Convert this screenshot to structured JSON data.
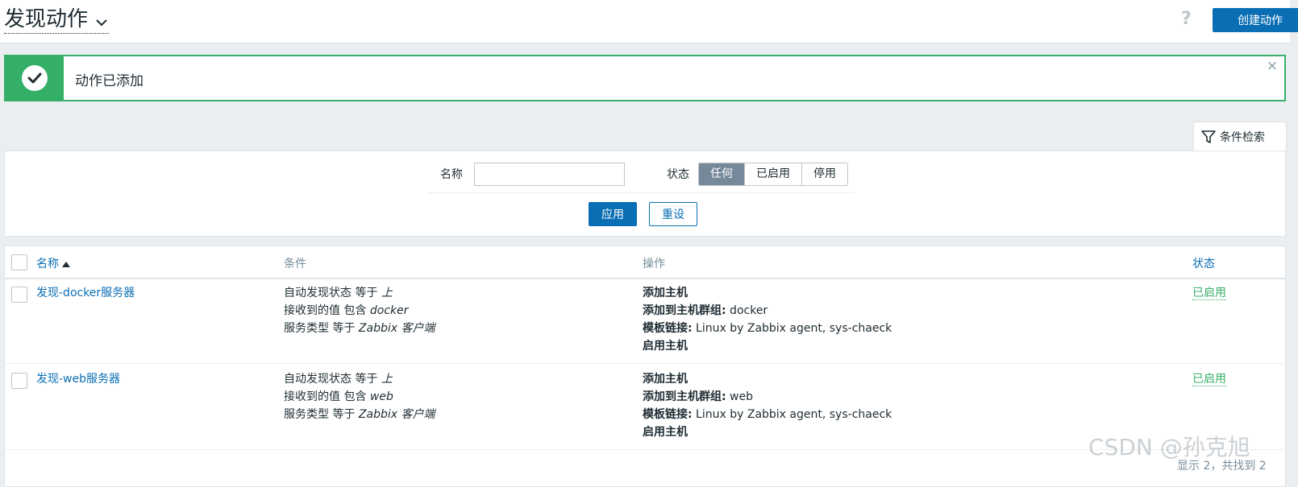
{
  "header": {
    "title": "发现动作",
    "help_icon": "question-icon",
    "create_button": "创建动作"
  },
  "message": {
    "text": "动作已添加",
    "icon": "check-circle-icon",
    "close": "×"
  },
  "filter": {
    "tab_label": "条件检索",
    "name_label": "名称",
    "name_value": "",
    "status_label": "状态",
    "status_options": [
      "任何",
      "已启用",
      "停用"
    ],
    "status_selected": "任何",
    "apply": "应用",
    "reset": "重设"
  },
  "table": {
    "columns": {
      "name": "名称",
      "conditions": "条件",
      "operations": "操作",
      "status": "状态"
    },
    "sort": "name-asc",
    "rows": [
      {
        "name": "发现-docker服务器",
        "conditions": [
          {
            "text": "自动发现状态 等于 ",
            "value": "上"
          },
          {
            "text": "接收到的值 包含 ",
            "value": "docker"
          },
          {
            "text": "服务类型 等于 ",
            "value": "Zabbix 客户端"
          }
        ],
        "operations": [
          {
            "label": "添加主机",
            "value": ""
          },
          {
            "label": "添加到主机群组:",
            "value": " docker"
          },
          {
            "label": "模板链接:",
            "value": " Linux by Zabbix agent, sys-chaeck"
          },
          {
            "label": "启用主机",
            "value": ""
          }
        ],
        "status": "已启用"
      },
      {
        "name": "发现-web服务器",
        "conditions": [
          {
            "text": "自动发现状态 等于 ",
            "value": "上"
          },
          {
            "text": "接收到的值 包含 ",
            "value": "web"
          },
          {
            "text": "服务类型 等于 ",
            "value": "Zabbix 客户端"
          }
        ],
        "operations": [
          {
            "label": "添加主机",
            "value": ""
          },
          {
            "label": "添加到主机群组:",
            "value": " web"
          },
          {
            "label": "模板链接:",
            "value": " Linux by Zabbix agent, sys-chaeck"
          },
          {
            "label": "启用主机",
            "value": ""
          }
        ],
        "status": "已启用"
      }
    ]
  },
  "footer": {
    "summary": "显示 2，共找到 2"
  },
  "watermark": "CSDN @孙克旭",
  "colors": {
    "accent": "#0a6eb4",
    "success": "#34af67",
    "selected_segment": "#76899a"
  }
}
